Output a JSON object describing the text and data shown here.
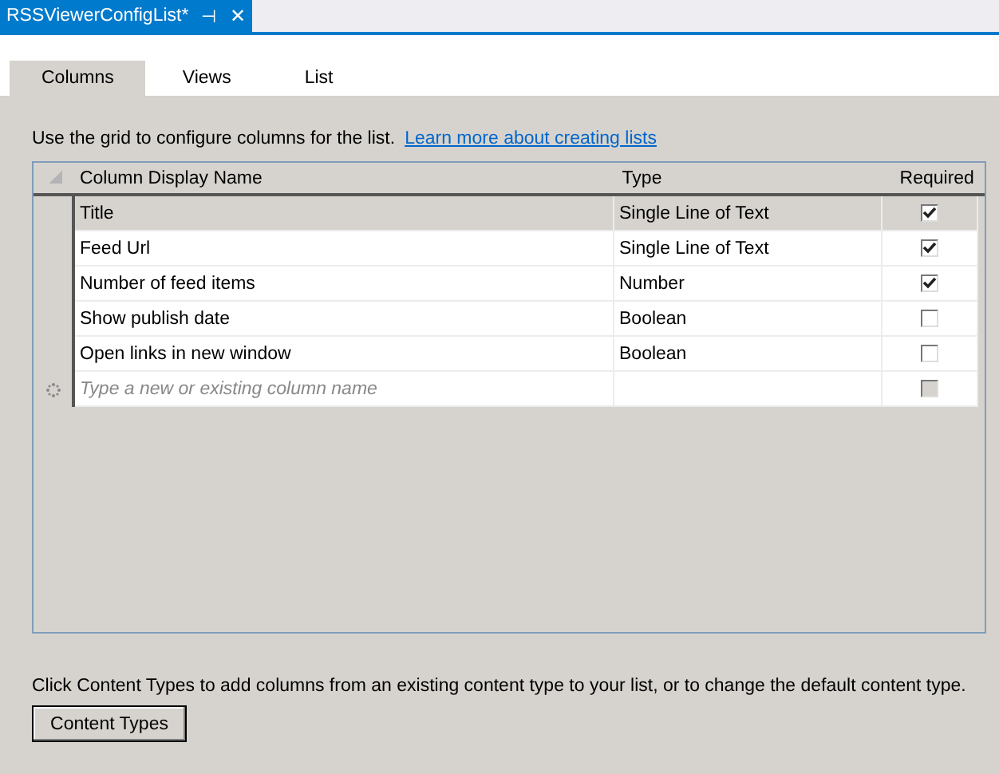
{
  "document_tab": {
    "title": "RSSViewerConfigList*",
    "pin": "⊣",
    "close": "✕"
  },
  "tabs": [
    {
      "label": "Columns",
      "selected": true
    },
    {
      "label": "Views",
      "selected": false
    },
    {
      "label": "List",
      "selected": false
    }
  ],
  "intro": {
    "text": "Use the grid to configure columns for the list.",
    "link": "Learn more about creating lists"
  },
  "grid": {
    "columns": [
      "Column Display Name",
      "Type",
      "Required"
    ],
    "rows": [
      {
        "name": "Title",
        "type": "Single Line of Text",
        "required": true,
        "selected": true
      },
      {
        "name": "Feed Url",
        "type": "Single Line of Text",
        "required": true,
        "selected": false
      },
      {
        "name": "Number of feed items",
        "type": "Number",
        "required": true,
        "selected": false
      },
      {
        "name": "Show publish date",
        "type": "Boolean",
        "required": false,
        "selected": false
      },
      {
        "name": "Open links in new window",
        "type": "Boolean",
        "required": false,
        "selected": false
      }
    ],
    "new_row": {
      "placeholder": "Type a new or existing column name",
      "required": false,
      "disabled": true
    }
  },
  "footer": {
    "text": "Click Content Types to add columns from an existing content type to your list, or to change the default content type.",
    "button": "Content Types"
  }
}
